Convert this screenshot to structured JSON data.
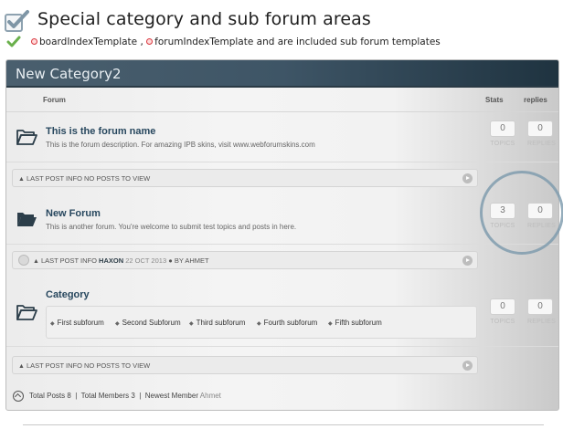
{
  "header": {
    "title": "Special category and sub forum areas",
    "subtitle_parts": [
      "boardIndexTemplate ,",
      "forumIndexTemplate and  are included sub forum templates"
    ],
    "check_color": "#6ab04c",
    "accent_dot_color": "#d9363e"
  },
  "category": {
    "title": "New Category2",
    "columns": {
      "forum": "Forum",
      "stats": "Stats",
      "replies": "replies"
    }
  },
  "forums": [
    {
      "name": "This is the forum name",
      "description": "This is the forum description. For amazing IPB skins, visit www.webforumskins.com",
      "topics": "0",
      "topics_label": "TOPICS",
      "replies": "0",
      "replies_label": "REPLIES",
      "last_post": "LAST POST INFO NO POSTS TO VIEW"
    },
    {
      "name": "New Forum",
      "description": "This is another forum. You're welcome to submit test topics and posts in here.",
      "topics": "3",
      "topics_label": "TOPICS",
      "replies": "0",
      "replies_label": "REPLIES",
      "last_post_prefix": "LAST POST INFO",
      "last_post_title": "HAXON",
      "last_post_date": "22 OCT 2013",
      "last_post_by": "BY AHMET"
    },
    {
      "name": "Category",
      "subforums": [
        "First subforum",
        "Second Subforum",
        "Third subforum",
        "Fourth subforum",
        "Fifth subforum"
      ],
      "topics": "0",
      "topics_label": "TOPICS",
      "replies": "0",
      "replies_label": "REPLIES",
      "last_post": "LAST POST INFO NO POSTS TO VIEW"
    }
  ],
  "footer": {
    "total_posts": "Total Posts 8",
    "total_members": "Total Members 3",
    "newest_member_label": "Newest Member",
    "newest_member": "Ahmet"
  }
}
